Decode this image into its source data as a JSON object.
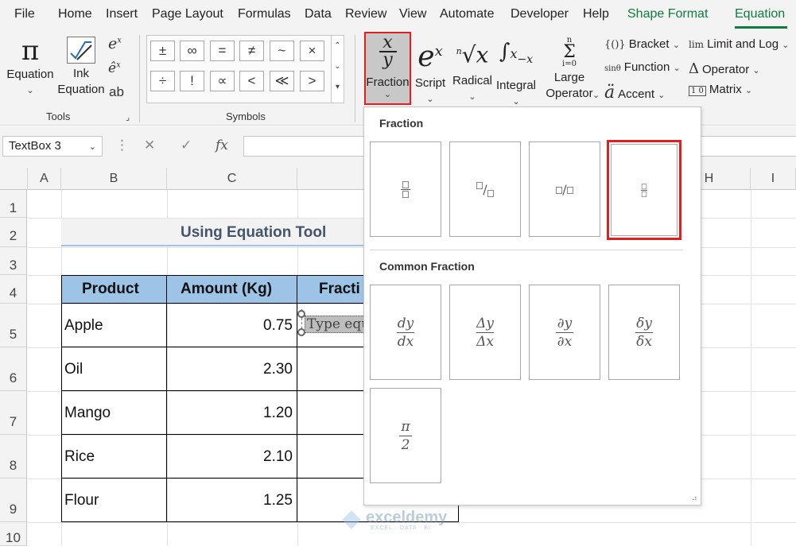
{
  "menu": {
    "tabs": [
      "File",
      "Home",
      "Insert",
      "Page Layout",
      "Formulas",
      "Data",
      "Review",
      "View",
      "Automate",
      "Developer",
      "Help",
      "Shape Format",
      "Equation"
    ],
    "active": "Equation"
  },
  "ribbon": {
    "equation_label": "Equation",
    "ink_label_1": "Ink",
    "ink_label_2": "Equation",
    "tools_label": "Tools",
    "symbols_label": "Symbols",
    "symbols_row1": [
      "±",
      "∞",
      "=",
      "≠",
      "~",
      "×"
    ],
    "symbols_row2": [
      "÷",
      "!",
      "∝",
      "<",
      "≪",
      ">"
    ],
    "fraction_label": "Fraction",
    "script_label": "Script",
    "radical_label": "Radical",
    "integral_label": "Integral",
    "large_op_1": "Large",
    "large_op_2": "Operator",
    "bracket_label": "Bracket",
    "function_label": "Function",
    "accent_label": "Accent",
    "limit_label": "Limit and Log",
    "operator_label": "Operator",
    "matrix_label": "Matrix"
  },
  "formula_bar": {
    "name_box": "TextBox 3",
    "fx": "fx"
  },
  "grid": {
    "columns": [
      "A",
      "B",
      "C",
      "H",
      "I"
    ],
    "rows": [
      "1",
      "2",
      "3",
      "4",
      "5",
      "6",
      "7",
      "8",
      "9",
      "10"
    ],
    "title": "Using Equation Tool",
    "headers": [
      "Product",
      "Amount (Kg)",
      "Fracti"
    ],
    "products": [
      "Apple",
      "Oil",
      "Mango",
      "Rice",
      "Flour"
    ],
    "amounts": [
      "0.75",
      "2.30",
      "1.20",
      "2.10",
      "1.25"
    ],
    "textbox_placeholder": "Type equ"
  },
  "dropdown": {
    "fraction_heading": "Fraction",
    "common_heading": "Common Fraction",
    "common": [
      {
        "num": "dy",
        "den": "dx"
      },
      {
        "num": "Δy",
        "den": "Δx"
      },
      {
        "num": "∂y",
        "den": "∂x"
      },
      {
        "num": "δy",
        "den": "δx"
      },
      {
        "num": "π",
        "den": "2"
      }
    ]
  },
  "watermark": {
    "name": "exceldemy",
    "tagline": "EXCEL · DATA · BI"
  },
  "colors": {
    "accent": "#107c41",
    "header_fill": "#9dc3e6",
    "highlight": "#e02020"
  }
}
